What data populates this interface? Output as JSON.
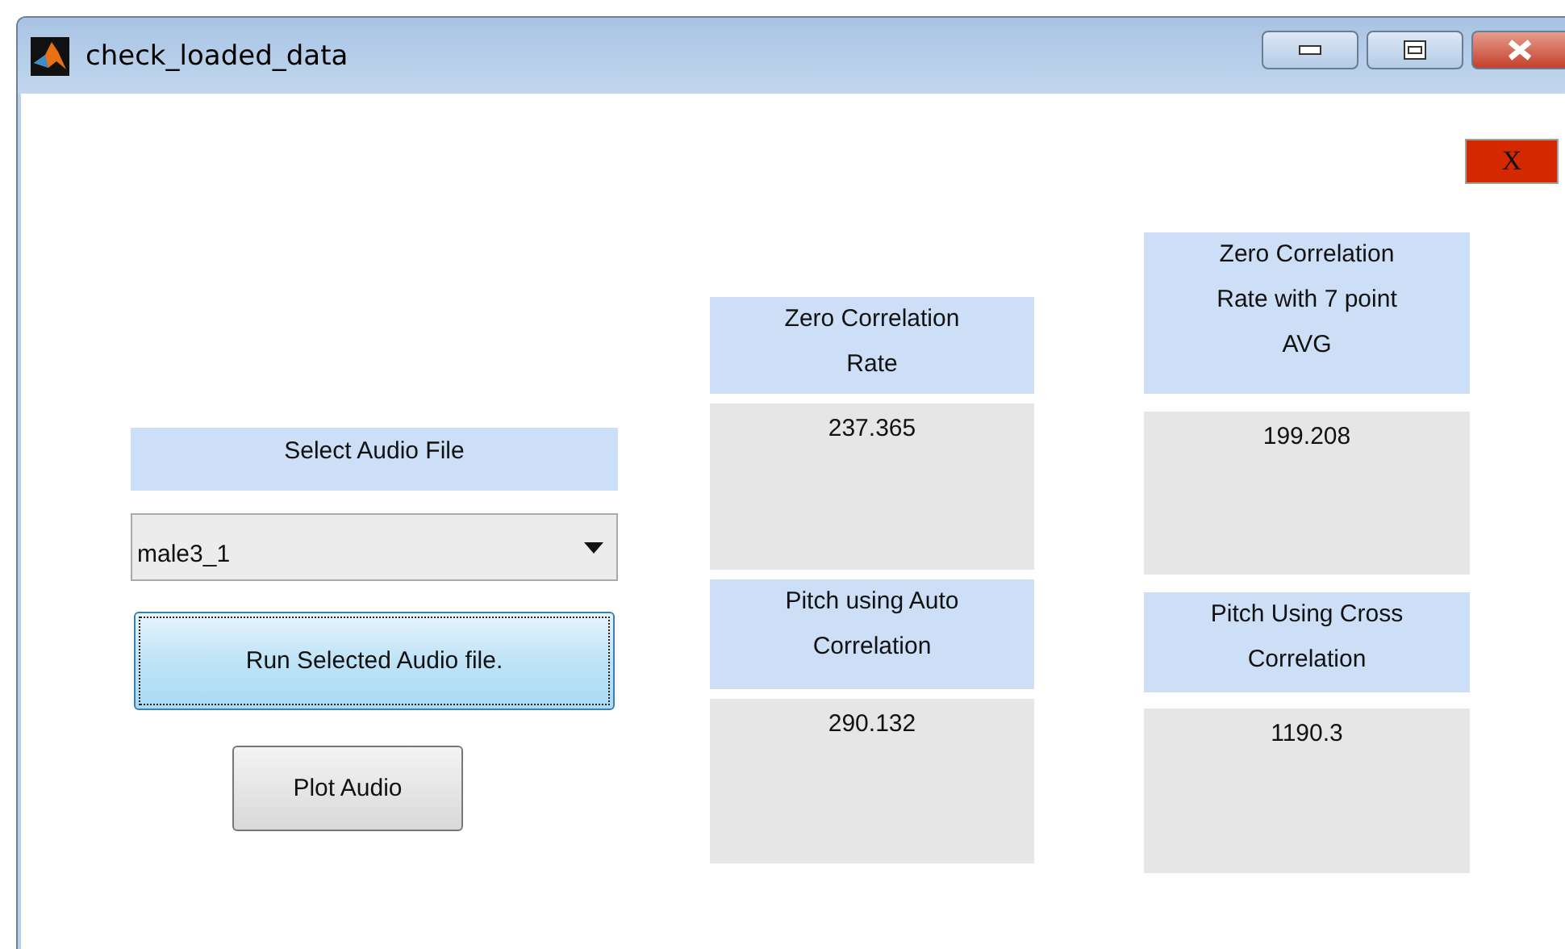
{
  "window": {
    "title": "check_loaded_data"
  },
  "close_button": {
    "label": "X"
  },
  "audio_select": {
    "label": "Select Audio File",
    "value": "male3_1"
  },
  "buttons": [
    {
      "label": "Run Selected Audio file.",
      "focused": true
    },
    {
      "label": "Plot Audio",
      "focused": false
    }
  ],
  "result_columns": [
    [
      {
        "label": "Zero Correlation Rate",
        "value": "237.365"
      },
      {
        "label": "Pitch using Auto Correlation",
        "value": "290.132"
      }
    ],
    [
      {
        "label": "Zero Correlation Rate with 7 point AVG",
        "value": "199.208"
      },
      {
        "label": "Pitch Using Cross Correlation",
        "value": "1190.3"
      }
    ]
  ]
}
